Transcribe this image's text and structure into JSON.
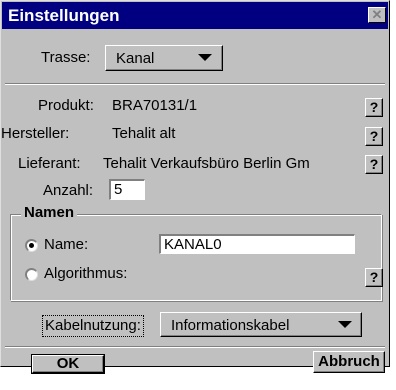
{
  "window": {
    "title": "Einstellungen",
    "close_glyph": "✕"
  },
  "trasse": {
    "label": "Trasse:",
    "value": "Kanal"
  },
  "info": {
    "produkt_label": "Produkt:",
    "produkt_value": "BRA70131/1",
    "hersteller_label": "Hersteller:",
    "hersteller_value": "Tehalit alt",
    "lieferant_label": "Lieferant:",
    "lieferant_value": "Tehalit Verkaufsbüro Berlin Gm",
    "help_glyph": "?"
  },
  "anzahl": {
    "label": "Anzahl:",
    "value": "5"
  },
  "namen": {
    "group_title": "Namen",
    "name_option": "Name:",
    "name_value": "KANAL0",
    "name_selected": true,
    "algorithmus_option": "Algorithmus:"
  },
  "kabel": {
    "label": "Kabelnutzung:",
    "value": "Informationskabel"
  },
  "buttons": {
    "ok": "OK",
    "cancel": "Abbruch"
  },
  "colors": {
    "title_bar": "#000080",
    "face": "#c0c0c0"
  }
}
